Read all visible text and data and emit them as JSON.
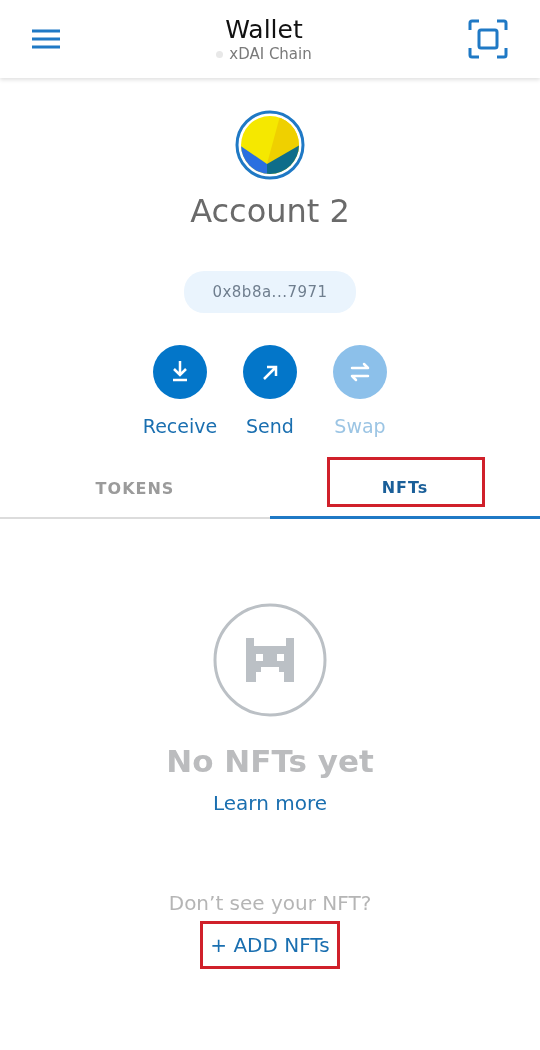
{
  "header": {
    "title": "Wallet",
    "network": "xDAI Chain"
  },
  "account": {
    "name": "Account 2",
    "address": "0x8b8a...7971"
  },
  "actions": [
    {
      "kind": "receive",
      "label": "Receive",
      "disabled": false
    },
    {
      "kind": "send",
      "label": "Send",
      "disabled": false
    },
    {
      "kind": "swap",
      "label": "Swap",
      "disabled": true
    }
  ],
  "tabs": [
    {
      "label": "TOKENS",
      "selected": false,
      "highlighted": false
    },
    {
      "label": "NFTs",
      "selected": true,
      "highlighted": true
    }
  ],
  "empty_state": {
    "title": "No NFTs yet",
    "link": "Learn more",
    "prompt": "Don’t see your NFT?",
    "add_button": {
      "label": "+ ADD NFTs",
      "highlighted": true
    }
  }
}
